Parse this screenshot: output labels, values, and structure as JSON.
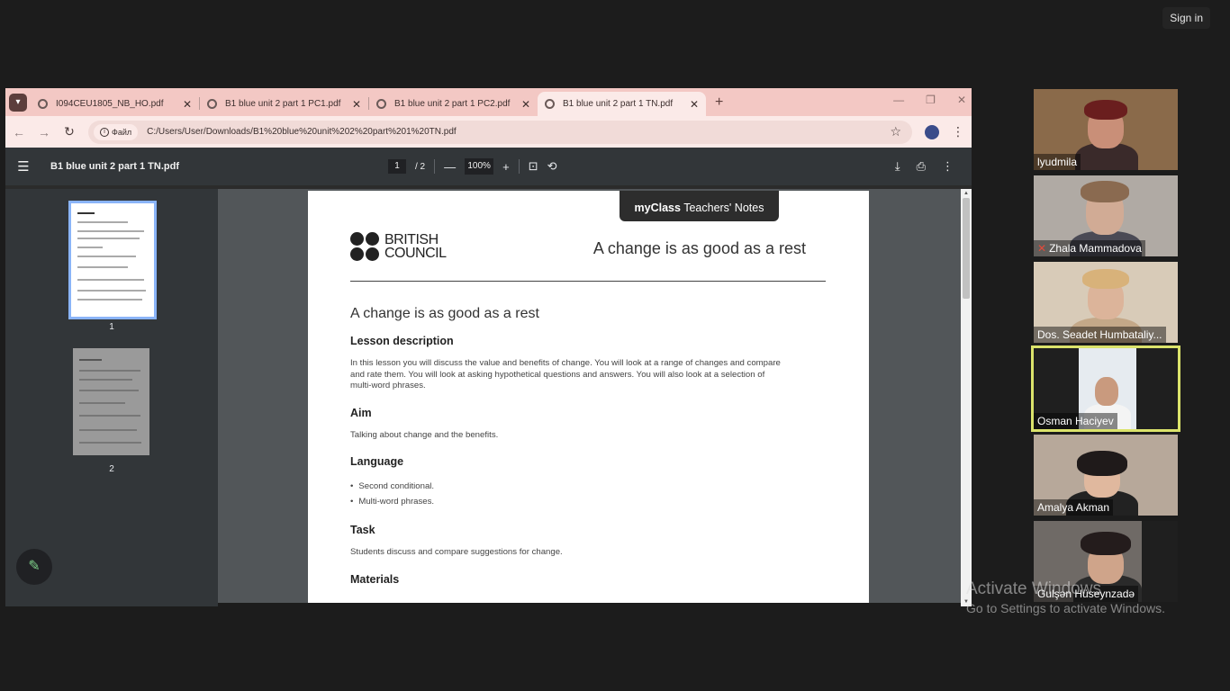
{
  "signin": {
    "label": "Sign in"
  },
  "browser": {
    "tabs": [
      {
        "title": "I094CEU1805_NB_HO.pdf",
        "active": false
      },
      {
        "title": "B1 blue unit 2 part 1 PC1.pdf",
        "active": false
      },
      {
        "title": "B1 blue unit 2 part 1 PC2.pdf",
        "active": false
      },
      {
        "title": "B1 blue unit 2 part 1 TN.pdf",
        "active": true
      }
    ],
    "address": {
      "file_chip": "Файл",
      "url": "C:/Users/User/Downloads/B1%20blue%20unit%202%20part%201%20TN.pdf"
    }
  },
  "pdf": {
    "title": "B1 blue unit 2 part 1 TN.pdf",
    "current_page": "1",
    "total_pages": "/ 2",
    "zoom": "100%",
    "thumbnails": [
      {
        "num": "1"
      },
      {
        "num": "2"
      }
    ],
    "page": {
      "badge_bold": "myClass",
      "badge_rest": " Teachers' Notes",
      "logo_line1": "BRITISH",
      "logo_line2": "COUNCIL",
      "header_title": "A change is as good as a rest",
      "title": "A change is as good as a rest",
      "sections": {
        "lesson_description": {
          "heading": "Lesson description",
          "text": "In this lesson you will discuss the value and benefits of change. You will look at a range of changes and compare and rate them. You will look at asking hypothetical questions and answers. You will also look at a selection of multi-word phrases."
        },
        "aim": {
          "heading": "Aim",
          "text": "Talking about change and the benefits."
        },
        "language": {
          "heading": "Language",
          "items": [
            "Second conditional.",
            "Multi-word phrases."
          ]
        },
        "task": {
          "heading": "Task",
          "text": "Students discuss and compare suggestions for change."
        },
        "materials": {
          "heading": "Materials"
        }
      }
    }
  },
  "participants": [
    {
      "name": "lyudmila",
      "muted": false,
      "active": false
    },
    {
      "name": "Zhala Mammadova",
      "muted": true,
      "active": false
    },
    {
      "name": "Dos. Seadet Humbataliy...",
      "muted": false,
      "active": false
    },
    {
      "name": "Osman Haciyev",
      "muted": false,
      "active": true
    },
    {
      "name": "Amalya Akman",
      "muted": false,
      "active": false
    },
    {
      "name": "Gulşən Hüseynzadə",
      "muted": false,
      "active": false
    }
  ],
  "watermark": {
    "line1": "Activate Windows",
    "line2": "Go to Settings to activate Windows."
  }
}
